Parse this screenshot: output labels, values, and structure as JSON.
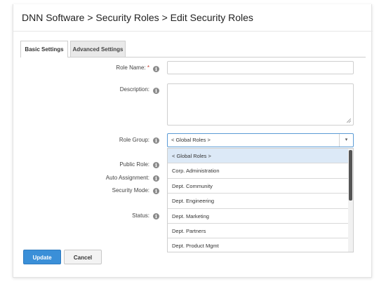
{
  "breadcrumb": "DNN Software > Security Roles > Edit Security Roles",
  "tabs": [
    {
      "label": "Basic Settings",
      "active": true
    },
    {
      "label": "Advanced Settings",
      "active": false
    }
  ],
  "form": {
    "role_name_label": "Role Name:",
    "required_marker": "*",
    "role_name_value": "",
    "description_label": "Description:",
    "description_value": "",
    "role_group_label": "Role Group:",
    "role_group_selected": "< Global Roles >",
    "public_role_label": "Public Role:",
    "auto_assignment_label": "Auto Assignment:",
    "security_mode_label": "Security Mode:",
    "status_label": "Status:"
  },
  "dropdown_options": [
    "< Global Roles >",
    "Corp. Administration",
    "Dept. Community",
    "Dept. Engineering",
    "Dept. Marketing",
    "Dept. Partners",
    "Dept. Product Mgmt"
  ],
  "buttons": {
    "update": "Update",
    "cancel": "Cancel"
  },
  "icons": {
    "info": "i",
    "chevron": "▾"
  },
  "colors": {
    "primary": "#3a8fd8",
    "selected_option": "#dce9f7",
    "required": "#c0392b"
  }
}
